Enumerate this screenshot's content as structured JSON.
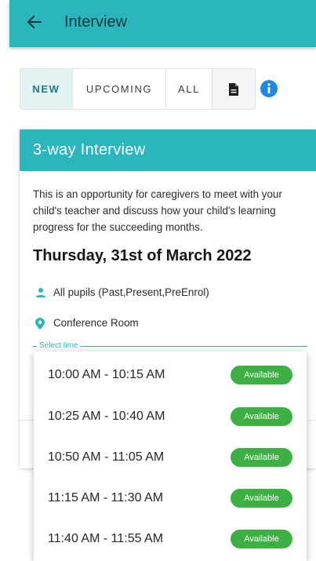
{
  "appbar": {
    "title": "Interview",
    "back_icon": "arrow-left-icon"
  },
  "tabs": [
    {
      "label": "NEW",
      "active": true
    },
    {
      "label": "UPCOMING",
      "active": false
    },
    {
      "label": "ALL",
      "active": false
    }
  ],
  "tab_doc_icon": "document-icon",
  "info_icon": "info-icon",
  "card": {
    "title": "3-way Interview",
    "description": "This is an opportunity for caregivers to meet with your child's teacher and discuss how your child's learning progress for the succeeding months.",
    "date": "Thursday, 31st of March 2022",
    "audience": "All pupils (Past,Present,PreEnrol)",
    "location": "Conference Room",
    "select_label": "Select time"
  },
  "time_options": [
    {
      "time": "10:00 AM - 10:15 AM",
      "status": "Available"
    },
    {
      "time": "10:25 AM - 10:40 AM",
      "status": "Available"
    },
    {
      "time": "10:50 AM - 11:05 AM",
      "status": "Available"
    },
    {
      "time": "11:15 AM - 11:30 AM",
      "status": "Available"
    },
    {
      "time": "11:40 AM - 11:55 AM",
      "status": "Available"
    }
  ],
  "colors": {
    "primary": "#2bb5bd",
    "badge": "#3cb043",
    "info": "#1e88e5"
  }
}
